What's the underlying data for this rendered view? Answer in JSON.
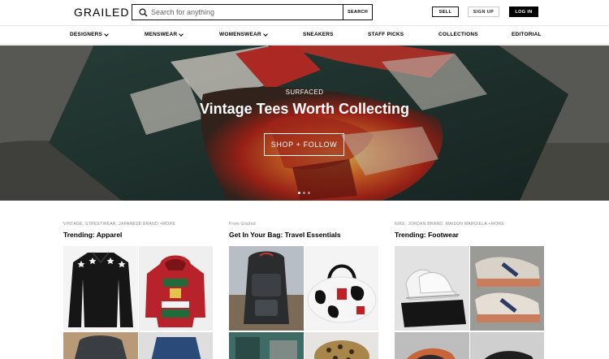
{
  "header": {
    "logo": "GRAILED",
    "search_placeholder": "Search for anything",
    "search_button": "SEARCH",
    "sell_button": "SELL",
    "signup_button": "SIGN UP",
    "login_button": "LOG IN"
  },
  "nav": {
    "items": [
      {
        "label": "DESIGNERS",
        "dropdown": true
      },
      {
        "label": "MENSWEAR",
        "dropdown": true
      },
      {
        "label": "WOMENSWEAR",
        "dropdown": true
      },
      {
        "label": "SNEAKERS",
        "dropdown": false
      },
      {
        "label": "STAFF PICKS",
        "dropdown": false
      },
      {
        "label": "COLLECTIONS",
        "dropdown": false
      },
      {
        "label": "EDITORIAL",
        "dropdown": false
      }
    ]
  },
  "hero": {
    "eyebrow": "SURFACED",
    "title": "Vintage Tees Worth Collecting",
    "cta": "SHOP + FOLLOW",
    "slide_count": 3,
    "active_slide": 1
  },
  "cards": [
    {
      "tags": "VINTAGE, STREETWEAR, JAPANESE BRAND +MORE",
      "title": "Trending: Apparel"
    },
    {
      "tags": "From Grailed",
      "title": "Get In Your Bag: Travel Essentials"
    },
    {
      "tags": "NIKE, JORDAN BRAND, MAISON MARGIELA +MORE",
      "title": "Trending: Footwear"
    }
  ],
  "colors": {
    "accent": "#000000",
    "border": "#e6e6e6",
    "muted_text": "#888888"
  },
  "icons": {
    "search": "search-icon"
  }
}
